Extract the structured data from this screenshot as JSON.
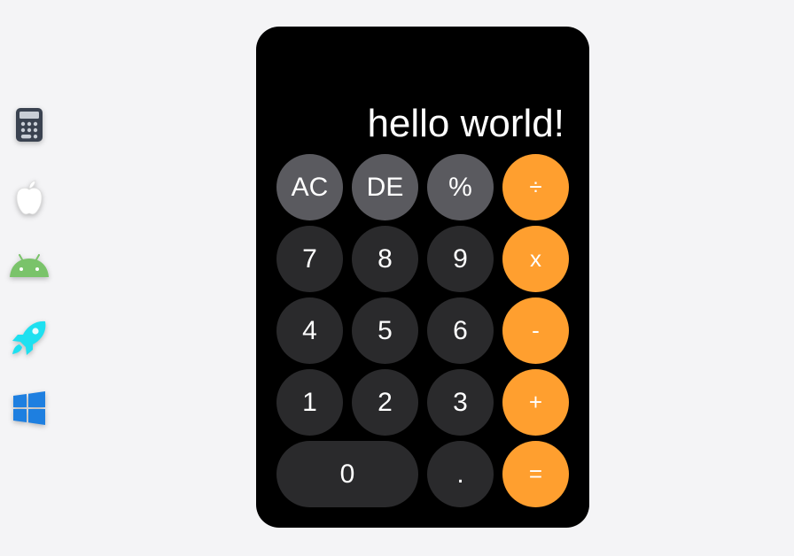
{
  "dock": {
    "items": [
      {
        "name": "calculator",
        "icon": "calculator-icon",
        "color": "#3a4250"
      },
      {
        "name": "apple",
        "icon": "apple-icon",
        "color": "#ffffff"
      },
      {
        "name": "android",
        "icon": "android-icon",
        "color": "#7ac36a"
      },
      {
        "name": "rocket",
        "icon": "rocket-icon",
        "color": "#1ee0f0"
      },
      {
        "name": "windows",
        "icon": "windows-icon",
        "color": "#1e7fe0"
      }
    ]
  },
  "display": {
    "value": "hello world!"
  },
  "keys": {
    "ac": "AC",
    "de": "DE",
    "percent": "%",
    "divide": "÷",
    "seven": "7",
    "eight": "8",
    "nine": "9",
    "multiply": "x",
    "four": "4",
    "five": "5",
    "six": "6",
    "subtract": "-",
    "one": "1",
    "two": "2",
    "three": "3",
    "add": "+",
    "zero": "0",
    "decimal": ".",
    "equals": "="
  },
  "colors": {
    "background": "#f4f4f6",
    "body": "#000000",
    "function_key": "#5a5a5f",
    "number_key": "#2a2a2c",
    "operator_key": "#ff9f2f",
    "text": "#ffffff"
  }
}
